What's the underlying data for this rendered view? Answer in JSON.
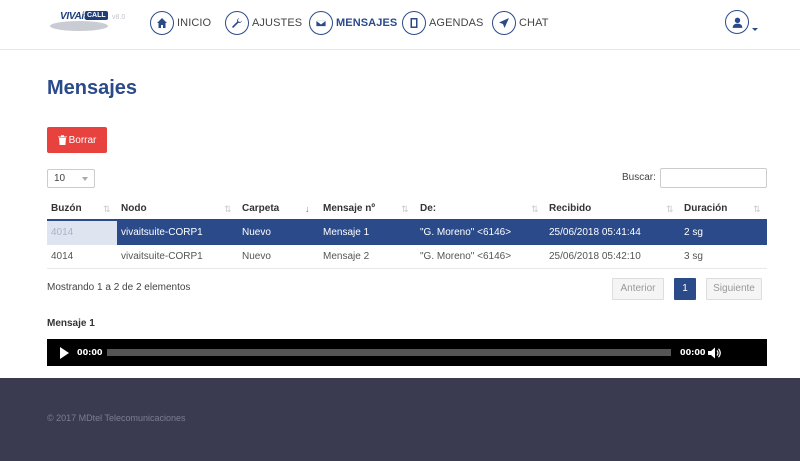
{
  "brand": {
    "logo_text": "VIVAit",
    "logo_badge": "CALL",
    "version": "v8.0"
  },
  "nav": {
    "items": [
      {
        "label": "INICIO",
        "icon": "home-icon"
      },
      {
        "label": "AJUSTES",
        "icon": "wrench-icon"
      },
      {
        "label": "MENSAJES",
        "icon": "envelope-icon"
      },
      {
        "label": "AGENDAS",
        "icon": "book-icon"
      },
      {
        "label": "CHAT",
        "icon": "send-icon"
      }
    ],
    "active": "MENSAJES",
    "user_icon": "user-icon"
  },
  "page": {
    "title": "Mensajes"
  },
  "toolbar": {
    "delete_label": "Borrar",
    "delete_icon": "trash-icon",
    "delete_color": "#e8423f"
  },
  "table_controls": {
    "page_length": "10",
    "search_label": "Buscar:",
    "search_value": ""
  },
  "table": {
    "columns": [
      "Buzón",
      "Nodo",
      "Carpeta",
      "Mensaje nº",
      "De:",
      "Recibido",
      "Duración"
    ],
    "sorted_column": "Carpeta",
    "rows": [
      {
        "buzon": "4014",
        "nodo": "vivaitsuite-CORP1",
        "carpeta": "Nuevo",
        "mensaje": "Mensaje 1",
        "de": "\"G. Moreno\" <6146>",
        "recibido": "25/06/2018 05:41:44",
        "duracion": "2 sg",
        "selected": true
      },
      {
        "buzon": "4014",
        "nodo": "vivaitsuite-CORP1",
        "carpeta": "Nuevo",
        "mensaje": "Mensaje 2",
        "de": "\"G. Moreno\" <6146>",
        "recibido": "25/06/2018 05:42:10",
        "duracion": "3 sg",
        "selected": false
      }
    ]
  },
  "pagination": {
    "info": "Mostrando 1 a 2 de 2 elementos",
    "prev_label": "Anterior",
    "current_page": "1",
    "next_label": "Siguiente"
  },
  "player": {
    "title": "Mensaje 1",
    "current_time": "00:00",
    "duration": "00:00",
    "progress": 0
  },
  "footer": {
    "copyright": "© 2017 MDtel Telecomunicaciones"
  },
  "colors": {
    "accent": "#2b4a8a",
    "footer_bg": "#3a3a50",
    "danger": "#e8423f"
  }
}
